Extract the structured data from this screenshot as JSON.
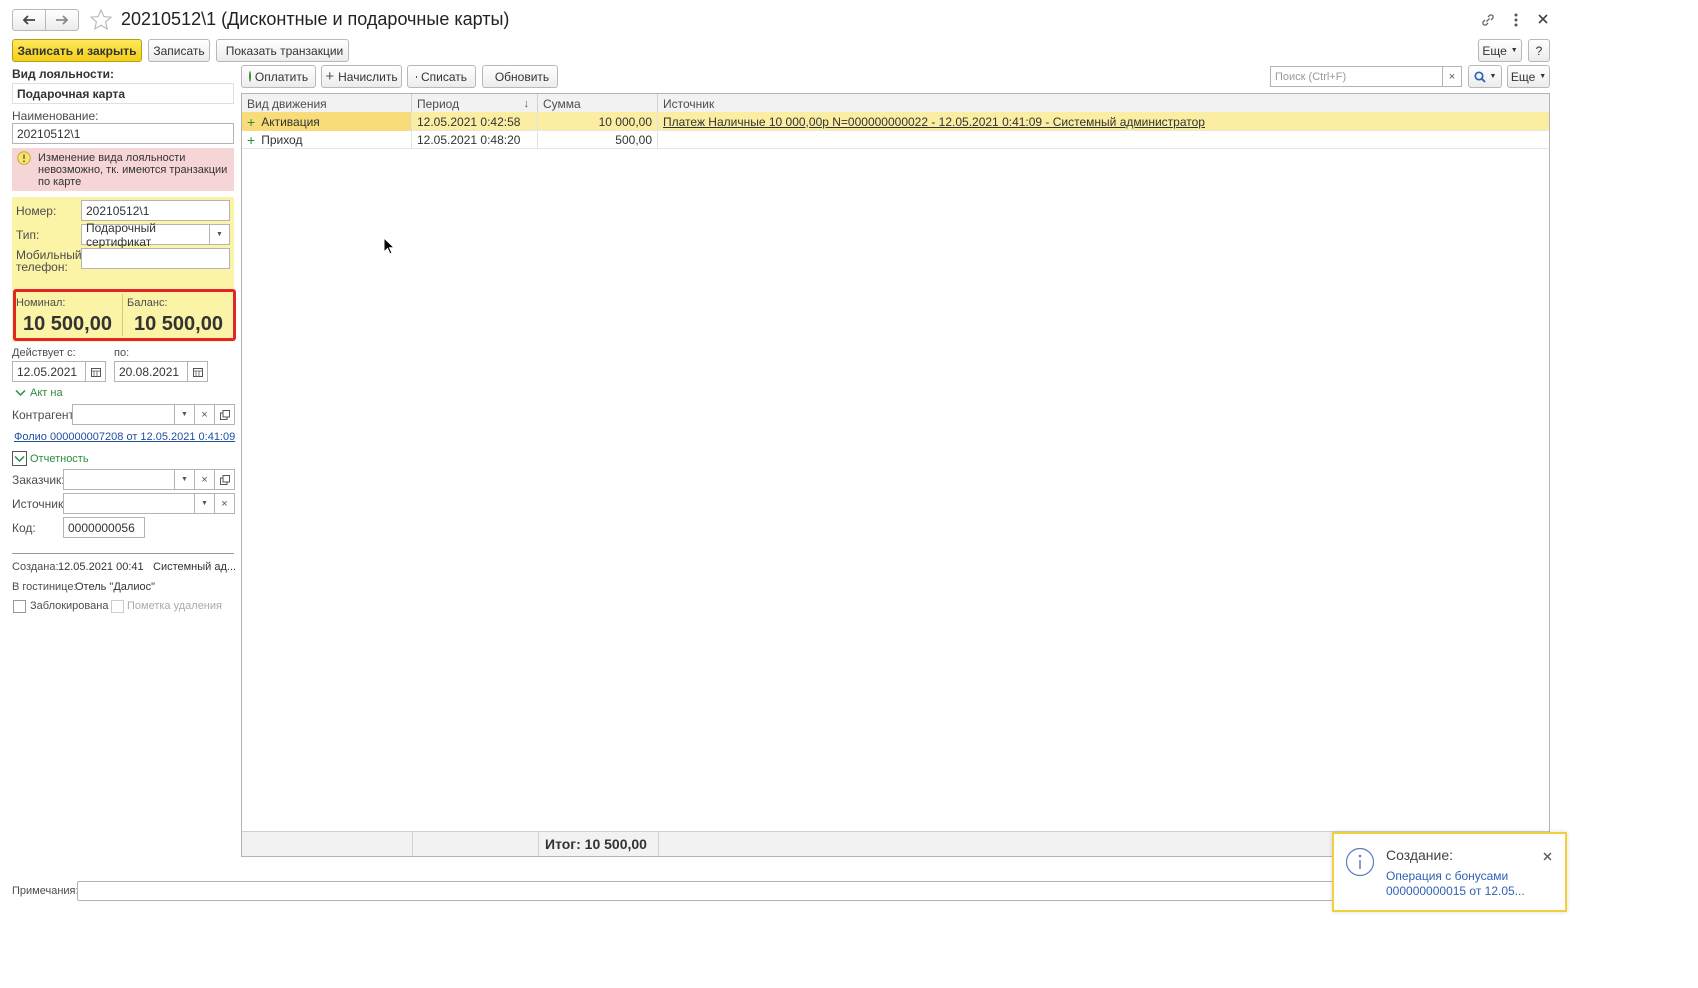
{
  "window": {
    "title": "20210512\\1 (Дисконтные и подарочные карты)"
  },
  "toolbar": {
    "save_close": "Записать и закрыть",
    "save": "Записать",
    "show_transactions": "Показать транзакции",
    "more": "Еще",
    "help": "?"
  },
  "left": {
    "loyalty_label": "Вид лояльности:",
    "loyalty_value": "Подарочная карта",
    "name_label": "Наименование:",
    "name_value": "20210512\\1",
    "warning": "Изменение вида лояльности невозможно, тк. имеются транзакции по карте",
    "number_label": "Номер:",
    "number_value": "20210512\\1",
    "type_label": "Тип:",
    "type_value": "Подарочный сертификат",
    "phone_label": "Мобильный телефон:",
    "phone_value": "",
    "nominal_label": "Номинал:",
    "nominal_value": "10 500,00",
    "balance_label": "Баланс:",
    "balance_value": "10 500,00",
    "valid_from_label": "Действует с:",
    "valid_from": "12.05.2021",
    "valid_to_label": "по:",
    "valid_to": "20.08.2021",
    "act_group": "Акт на",
    "counterparty_label": "Контрагент:",
    "folio_link": "Фолио 000000007208 от 12.05.2021 0:41:09",
    "reporting_group": "Отчетность",
    "customer_label": "Заказчик:",
    "source_label": "Источник:",
    "code_label": "Код:",
    "code_value": "0000000056",
    "created_label": "Создана:",
    "created_value": "12.05.2021 00:41",
    "created_by": "Системный ад...",
    "hotel_label": "В гостинице:",
    "hotel_value": "Отель \"Далиос\"",
    "blocked": "Заблокирована",
    "deletion_mark": "Пометка удаления",
    "notes_label": "Примечания:"
  },
  "transactions": {
    "pay": "Оплатить",
    "accrue": "Начислить",
    "writeoff": "Списать",
    "refresh": "Обновить",
    "search_placeholder": "Поиск (Ctrl+F)",
    "more": "Еще",
    "columns": [
      "Вид движения",
      "Период",
      "Сумма",
      "Источник"
    ],
    "rows": [
      {
        "kind": "Активация",
        "period": "12.05.2021 0:42:58",
        "sum": "10 000,00",
        "source": "Платеж Наличные 10 000,00р N=000000000022 - 12.05.2021 0:41:09 - Системный администратор"
      },
      {
        "kind": "Приход",
        "period": "12.05.2021 0:48:20",
        "sum": "500,00",
        "source": ""
      }
    ],
    "total": "Итог: 10 500,00"
  },
  "notification": {
    "title": "Создание:",
    "text": "Операция с бонусами 000000000015 от 12.05..."
  }
}
